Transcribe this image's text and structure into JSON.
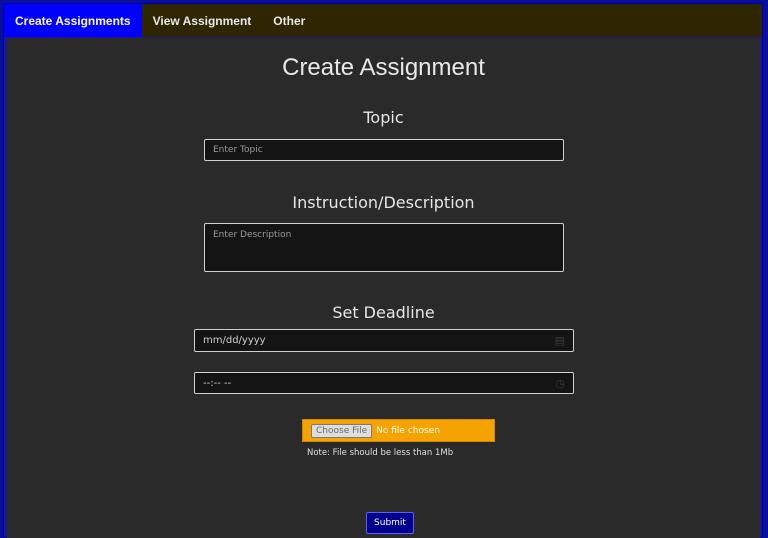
{
  "nav": {
    "tabs": [
      {
        "label": "Create Assignments",
        "active": true
      },
      {
        "label": "View Assignment",
        "active": false
      },
      {
        "label": "Other",
        "active": false
      }
    ]
  },
  "form": {
    "title": "Create Assignment",
    "topic": {
      "label": "Topic",
      "placeholder": "Enter Topic",
      "value": ""
    },
    "description": {
      "label": "Instruction/Description",
      "placeholder": "Enter Description",
      "value": ""
    },
    "deadline": {
      "label": "Set Deadline",
      "date_placeholder": "mm/dd/yyyy",
      "time_placeholder": "--:-- --",
      "date_icon": "calendar-icon",
      "time_icon": "clock-icon"
    },
    "file": {
      "button_label": "Choose File",
      "status": "No file chosen",
      "note": "Note: File should be less than 1Mb"
    },
    "submit_label": "Submit"
  },
  "colors": {
    "active_tab": "#0000ff",
    "navbar": "#2d2600",
    "panel": "#2a2a2a",
    "file_box": "#f4a300",
    "submit": "#00008c"
  }
}
